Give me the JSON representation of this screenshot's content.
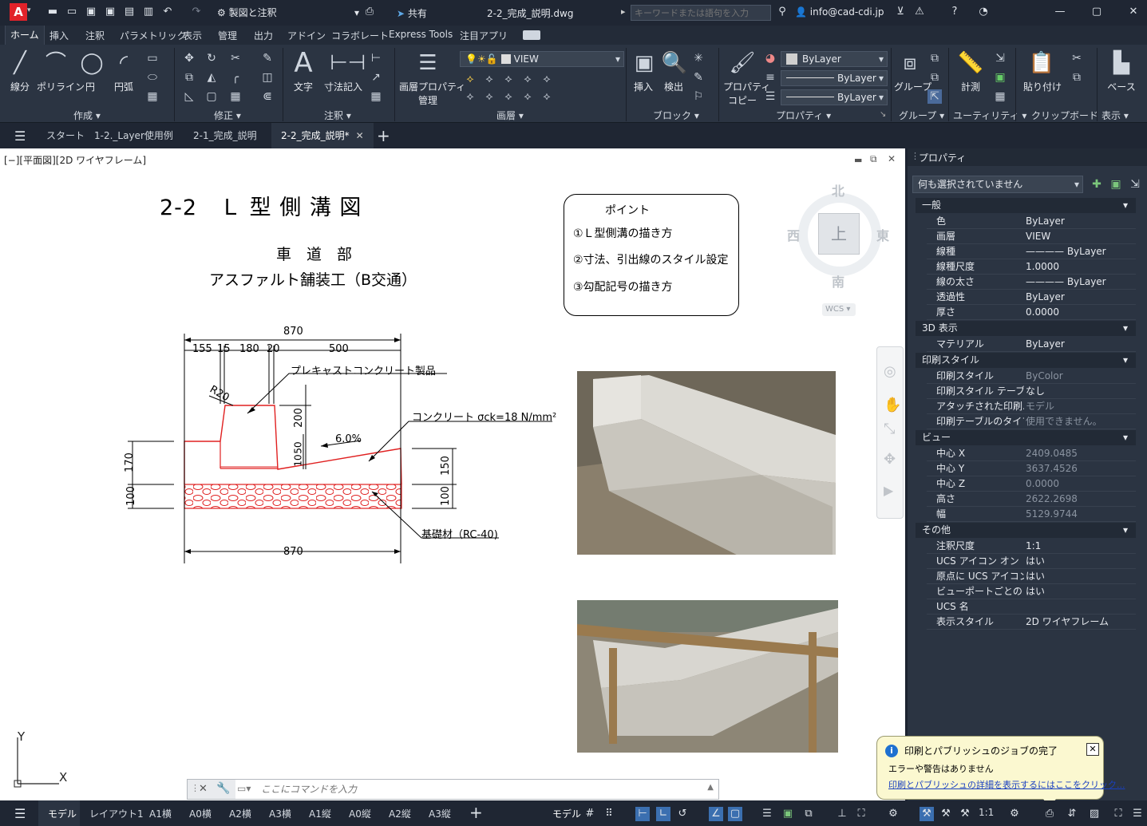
{
  "titlebar": {
    "app_letter": "A",
    "workspace": "製図と注釈",
    "share": "共有",
    "filename": "2-2_完成_説明.dwg",
    "search_placeholder": "キーワードまたは語句を入力",
    "user": "info@cad-cdi.jp"
  },
  "ribbon_tabs": [
    "ホーム",
    "挿入",
    "注釈",
    "パラメトリック",
    "表示",
    "管理",
    "出力",
    "アドイン",
    "コラボレート",
    "Express Tools",
    "注目アプリ"
  ],
  "ribbon": {
    "draw": {
      "title": "作成",
      "line": "線分",
      "polyline": "ポリライン",
      "circle": "円",
      "arc": "円弧"
    },
    "modify": {
      "title": "修正"
    },
    "annotation": {
      "title": "注釈",
      "text": "文字",
      "dimension": "寸法記入"
    },
    "layers": {
      "title": "画層",
      "layer_props": "画層プロパティ\n管理",
      "layer_props_l1": "画層プロパティ",
      "layer_props_l2": "管理",
      "current_layer": "VIEW"
    },
    "block": {
      "title": "ブロック",
      "insert": "挿入",
      "detect": "検出"
    },
    "properties": {
      "title": "プロパティ",
      "copy_l1": "プロパティ",
      "copy_l2": "コピー",
      "color": "ByLayer",
      "linetype": "ByLayer",
      "lineweight": "ByLayer"
    },
    "groups": {
      "title": "グループ",
      "group": "グループ"
    },
    "utilities": {
      "title": "ユーティリティ",
      "measure": "計測"
    },
    "clipboard": {
      "title": "クリップボード",
      "paste": "貼り付け"
    },
    "view": {
      "title": "表示",
      "base": "ベース"
    }
  },
  "doc_tabs": [
    "スタート",
    "1-2._Layer使用例",
    "2-1_完成_説明",
    "2-2_完成_説明*"
  ],
  "viewport": {
    "label": "[−][平面図][2D ワイヤフレーム]"
  },
  "drawing": {
    "title": "2-2　Ｌ 型 側 溝 図",
    "subtitle1": "車　道　部",
    "subtitle2": "アスファルト舗装工（B交通）",
    "points": {
      "heading": "ポイント",
      "items": [
        "①Ｌ型側溝の描き方",
        "②寸法、引出線のスタイル設定",
        "③勾配記号の描き方"
      ]
    },
    "dims": {
      "top_total": "870",
      "bottom_total": "870",
      "d155": "155",
      "d15": "15",
      "d180": "180",
      "d20": "20",
      "d500": "500",
      "r20": "R20",
      "h200": "200",
      "h50": "50",
      "h10": "10",
      "h170": "170",
      "h100l": "100",
      "h150": "150",
      "h100r": "100",
      "slope": "6.0%"
    },
    "labels": {
      "precast": "プレキャストコンクリート製品",
      "concrete": "コンクリート σck=18 N/mm²",
      "base": "基礎材（RC-40)"
    }
  },
  "viewcube": {
    "north": "北",
    "south": "南",
    "east": "東",
    "west": "西",
    "top": "上",
    "wcs": "WCS"
  },
  "command_line": {
    "placeholder": "ここにコマンドを入力"
  },
  "notification": {
    "title": "印刷とパブリッシュのジョブの完了",
    "body": "エラーや警告はありません",
    "link": "印刷とパブリッシュの詳細を表示するにはここをクリック..."
  },
  "properties_panel": {
    "title": "プロパティ",
    "selection": "何も選択されていません",
    "sections": [
      {
        "name": "一般",
        "rows": [
          [
            "色",
            "ByLayer"
          ],
          [
            "画層",
            "VIEW"
          ],
          [
            "線種",
            "———— ByLayer"
          ],
          [
            "線種尺度",
            "1.0000"
          ],
          [
            "線の太さ",
            "———— ByLayer"
          ],
          [
            "透過性",
            "ByLayer"
          ],
          [
            "厚さ",
            "0.0000"
          ]
        ]
      },
      {
        "name": "3D 表示",
        "rows": [
          [
            "マテリアル",
            "ByLayer"
          ]
        ]
      },
      {
        "name": "印刷スタイル",
        "rows": [
          [
            "印刷スタイル",
            "ByColor"
          ],
          [
            "印刷スタイル テーブル",
            "なし"
          ],
          [
            "アタッチされた印刷...",
            "モデル"
          ],
          [
            "印刷テーブルのタイプ",
            "使用できません。"
          ]
        ]
      },
      {
        "name": "ビュー",
        "rows": [
          [
            "中心 X",
            "2409.0485"
          ],
          [
            "中心 Y",
            "3637.4526"
          ],
          [
            "中心 Z",
            "0.0000"
          ],
          [
            "高さ",
            "2622.2698"
          ],
          [
            "幅",
            "5129.9744"
          ]
        ]
      },
      {
        "name": "その他",
        "rows": [
          [
            "注釈尺度",
            "1:1"
          ],
          [
            "UCS アイコン オン",
            "はい"
          ],
          [
            "原点に UCS アイコン",
            "はい"
          ],
          [
            "ビューポートごとの UCS",
            "はい"
          ],
          [
            "UCS 名",
            ""
          ],
          [
            "表示スタイル",
            "2D ワイヤフレーム"
          ]
        ]
      }
    ]
  },
  "status_tabs": [
    "モデル",
    "レイアウト1",
    "A1横",
    "A0横",
    "A2横",
    "A3横",
    "A1縦",
    "A0縦",
    "A2縦",
    "A3縦"
  ],
  "status": {
    "model": "モデル",
    "scale": "1:1"
  },
  "ucs": {
    "x": "X",
    "y": "Y"
  }
}
